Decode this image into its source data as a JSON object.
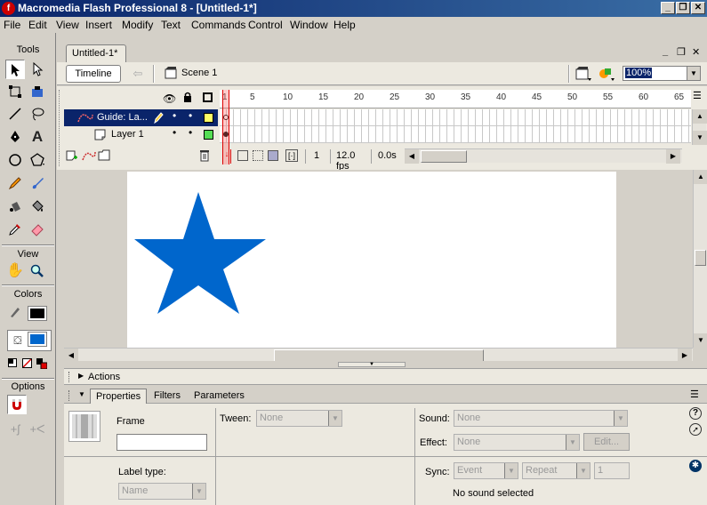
{
  "window": {
    "title": "Macromedia Flash Professional 8 - [Untitled-1*]",
    "app_icon": "flash-icon",
    "controls": [
      "_",
      "❐",
      "✕"
    ]
  },
  "menu": [
    "File",
    "Edit",
    "View",
    "Insert",
    "Modify",
    "Text",
    "Commands",
    "Control",
    "Window",
    "Help"
  ],
  "tools_panel": {
    "title": "Tools",
    "view_label": "View",
    "colors_label": "Colors",
    "options_label": "Options",
    "stroke_color": "#000000",
    "fill_color": "#0066cc"
  },
  "document": {
    "tab_label": "Untitled-1*",
    "doc_controls": [
      "_",
      "❐",
      "✕"
    ],
    "timeline_button": "Timeline",
    "scene_label": "Scene 1",
    "zoom": "100%"
  },
  "timeline": {
    "ruler_ticks": [
      "1",
      "5",
      "10",
      "15",
      "20",
      "25",
      "30",
      "35",
      "40",
      "45",
      "50",
      "55",
      "60",
      "65"
    ],
    "layers": [
      {
        "name": "Guide: La...",
        "type": "guide",
        "outline_color": "#ffff66",
        "selected": true
      },
      {
        "name": "Layer 1",
        "type": "normal",
        "outline_color": "#55dd55",
        "selected": false
      }
    ],
    "current_frame": "1",
    "fps": "12.0 fps",
    "elapsed": "0.0s"
  },
  "stage": {
    "star_color": "#0066cc"
  },
  "actions_panel": {
    "label": "Actions"
  },
  "properties_panel": {
    "tabs": [
      "Properties",
      "Filters",
      "Parameters"
    ],
    "active_tab": "Properties",
    "frame_label": "Frame",
    "frame_name_value": "",
    "label_type_label": "Label type:",
    "label_type_value": "Name",
    "tween_label": "Tween:",
    "tween_value": "None",
    "sound_label": "Sound:",
    "sound_value": "None",
    "effect_label": "Effect:",
    "effect_value": "None",
    "edit_button": "Edit...",
    "sync_label": "Sync:",
    "sync_value": "Event",
    "repeat_value": "Repeat",
    "repeat_count": "1",
    "sound_status": "No sound selected"
  }
}
